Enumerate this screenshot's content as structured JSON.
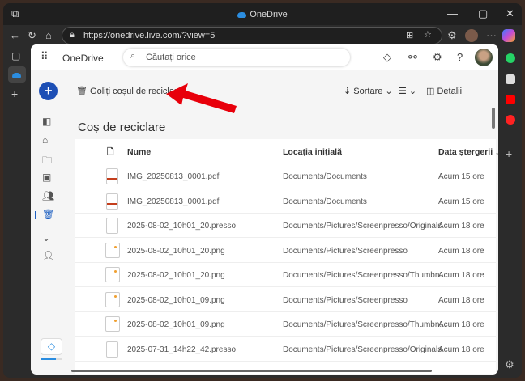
{
  "window": {
    "title": "OneDrive",
    "minimize": "—",
    "maximize": "▢",
    "close": "✕"
  },
  "browser": {
    "url": "https://onedrive.live.com/?view=5",
    "back": "←",
    "reload": "↻",
    "home": "⌂",
    "more": "···",
    "new_tab": "+"
  },
  "header": {
    "app_name": "OneDrive",
    "search_placeholder": "Căutați orice",
    "help": "?"
  },
  "commands": {
    "empty_bin": "Goliți coșul de reciclare",
    "sort": "Sortare",
    "details": "Detalii"
  },
  "page_title": "Coș de reciclare",
  "columns": {
    "name": "Nume",
    "location": "Locația inițială",
    "deleted": "Data ștergerii ↓"
  },
  "rows": [
    {
      "type": "pdf",
      "name": "IMG_20250813_0001.pdf",
      "location": "Documents/Documents",
      "deleted": "Acum 15 ore"
    },
    {
      "type": "pdf",
      "name": "IMG_20250813_0001.pdf",
      "location": "Documents/Documents",
      "deleted": "Acum 15 ore"
    },
    {
      "type": "file",
      "name": "2025-08-02_10h01_20.presso",
      "location": "Documents/Pictures/Screenpresso/Originals",
      "deleted": "Acum 18 ore"
    },
    {
      "type": "img",
      "name": "2025-08-02_10h01_20.png",
      "location": "Documents/Pictures/Screenpresso",
      "deleted": "Acum 18 ore"
    },
    {
      "type": "img",
      "name": "2025-08-02_10h01_20.png",
      "location": "Documents/Pictures/Screenpresso/Thumbn...",
      "deleted": "Acum 18 ore"
    },
    {
      "type": "img",
      "name": "2025-08-02_10h01_09.png",
      "location": "Documents/Pictures/Screenpresso",
      "deleted": "Acum 18 ore"
    },
    {
      "type": "img",
      "name": "2025-08-02_10h01_09.png",
      "location": "Documents/Pictures/Screenpresso/Thumbn...",
      "deleted": "Acum 18 ore"
    },
    {
      "type": "file",
      "name": "2025-07-31_14h22_42.presso",
      "location": "Documents/Pictures/Screenpresso/Originals",
      "deleted": "Acum 18 ore"
    }
  ],
  "colors": {
    "accent": "#1d4fb5",
    "arrow": "#e8000b"
  }
}
